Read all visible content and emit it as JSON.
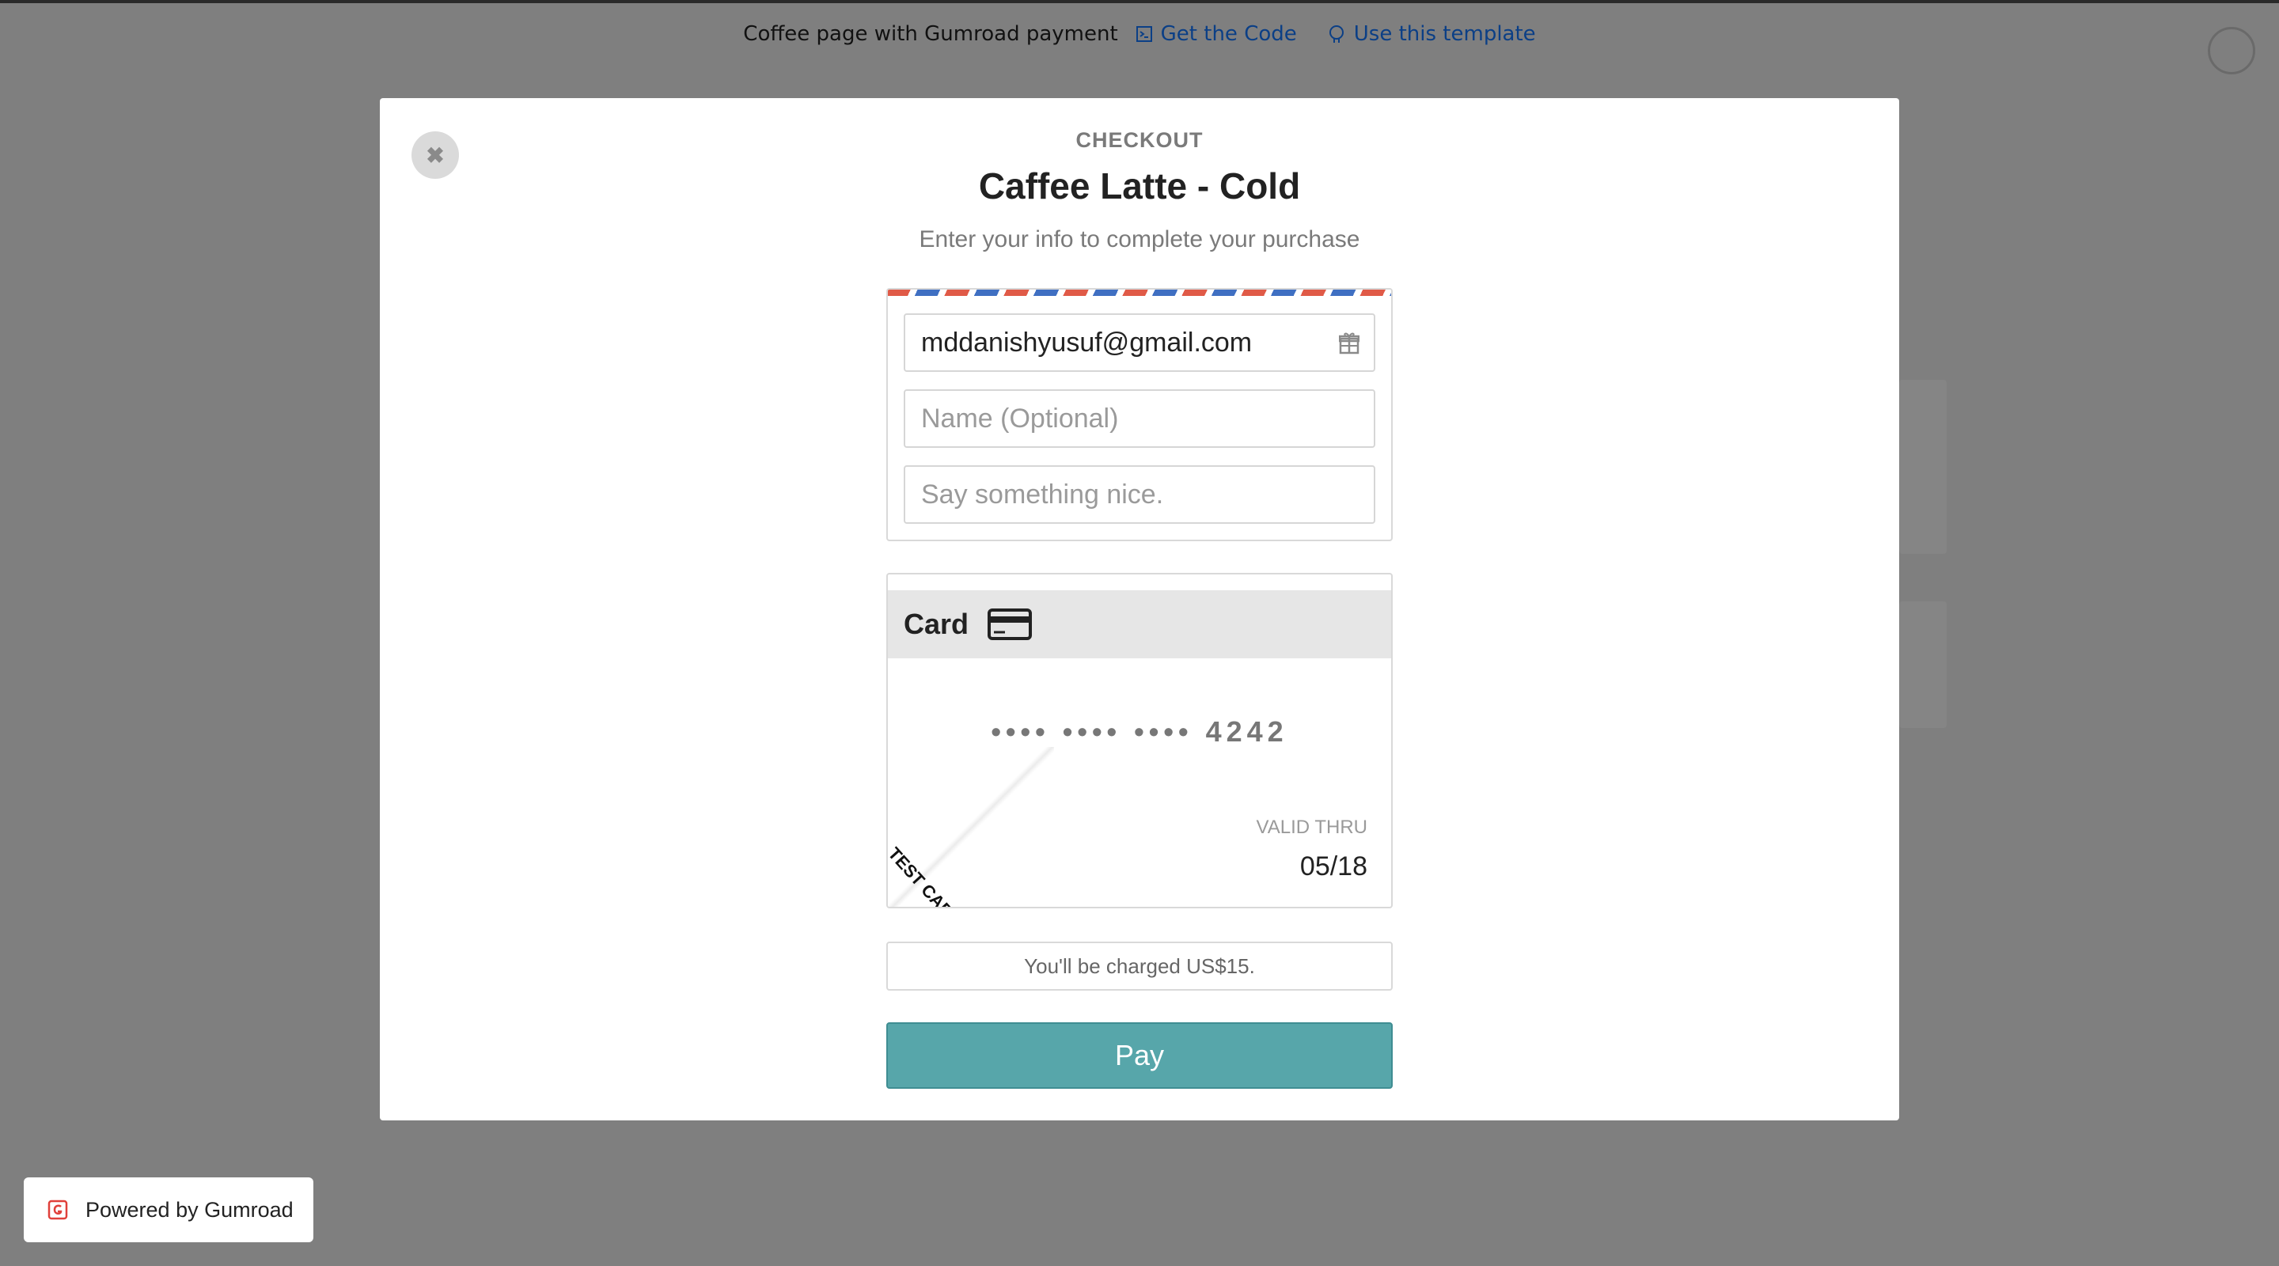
{
  "banner": {
    "title": "Coffee page with Gumroad payment",
    "get_code": "Get the Code",
    "use_template": "Use this template"
  },
  "modal": {
    "close_symbol": "✖",
    "checkout_label": "CHECKOUT",
    "product_title": "Caffee Latte - Cold",
    "subtitle": "Enter your info to complete your purchase"
  },
  "form": {
    "email_value": "mddanishyusuf@gmail.com",
    "name_placeholder": "Name (Optional)",
    "message_placeholder": "Say something nice."
  },
  "card": {
    "label": "Card",
    "number_masked": "•••• •••• •••• 4242",
    "test_card_label": "TEST CARD",
    "valid_thru_label": "VALID THRU",
    "valid_thru_value": "05/18"
  },
  "charge_text": "You'll be charged US$15.",
  "pay_label": "Pay",
  "powered_by": "Powered by Gumroad",
  "colors": {
    "overlay": "#7f7f7f",
    "pay_button": "#57a6aa",
    "airmail_red": "#e05a47",
    "airmail_blue": "#3f6fc2",
    "link": "#0b3f86"
  },
  "icons": {
    "get_code": "code-icon",
    "use_template": "github-icon",
    "email_field": "gift-icon",
    "card": "credit-card-icon",
    "gumroad": "gumroad-logo-icon"
  }
}
